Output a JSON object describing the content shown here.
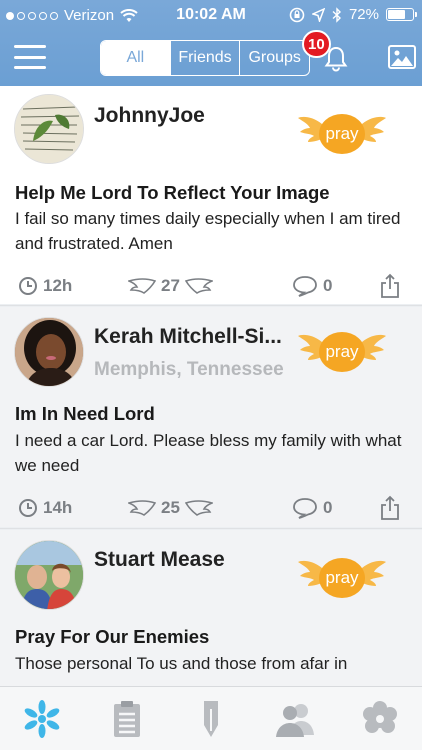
{
  "status_bar": {
    "carrier": "Verizon",
    "time": "10:02 AM",
    "battery": "72%",
    "battery_level": 0.72
  },
  "header": {
    "segments": [
      "All",
      "Friends",
      "Groups"
    ],
    "active_segment": "All",
    "notification_count": "10",
    "icons": [
      "menu-icon",
      "bell-icon",
      "photo-icon"
    ]
  },
  "colors": {
    "header": "#6b9fd3",
    "pray": "#f5a623",
    "badge": "#e31b23",
    "active_tab": "#3fb6e8"
  },
  "feed": {
    "posts": [
      {
        "author": "JohnnyJoe",
        "location": "",
        "pray_label": "pray",
        "title": "Help Me Lord To Reflect Your Image",
        "body": "I fail so many times daily especially when I am tired and frustrated. Amen",
        "time": "12h",
        "pray_count": "27",
        "comment_count": "0"
      },
      {
        "author": "Kerah Mitchell-Si...",
        "location": "Memphis, Tennessee",
        "pray_label": "pray",
        "title": "Im In Need Lord",
        "body": "I need a car Lord.  Please bless my family with what we need",
        "time": "14h",
        "pray_count": "25",
        "comment_count": "0"
      },
      {
        "author": "Stuart Mease",
        "location": "",
        "pray_label": "pray",
        "title": "Pray For Our Enemies",
        "body": "Those personal To us and those from afar in",
        "time": "",
        "pray_count": "",
        "comment_count": ""
      }
    ]
  },
  "tab_bar": {
    "tabs": [
      "prayers-tab-icon",
      "list-tab-icon",
      "journal-tab-icon",
      "friends-tab-icon",
      "settings-tab-icon"
    ],
    "active": "prayers-tab-icon"
  }
}
